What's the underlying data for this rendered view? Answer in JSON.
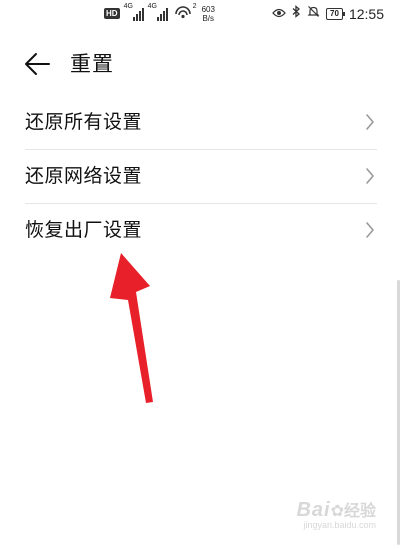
{
  "status_bar": {
    "hd_badge": "HD",
    "network_1": "4G",
    "network_2": "4G",
    "wifi_sub": "2",
    "speed_value": "603",
    "speed_unit": "B/s",
    "battery": "70",
    "time": "12:55",
    "icons": [
      "eye-icon",
      "bluetooth-icon",
      "mute-icon"
    ]
  },
  "header": {
    "title": "重置",
    "back_icon": "arrow-left-icon"
  },
  "settings": {
    "items": [
      {
        "label": "还原所有设置"
      },
      {
        "label": "还原网络设置"
      },
      {
        "label": "恢复出厂设置"
      }
    ]
  },
  "annotation": {
    "arrow_color": "#e8202a"
  },
  "watermark": {
    "brand": "Bai",
    "brand_suffix": "经验",
    "url": "jingyan.baidu.com"
  }
}
